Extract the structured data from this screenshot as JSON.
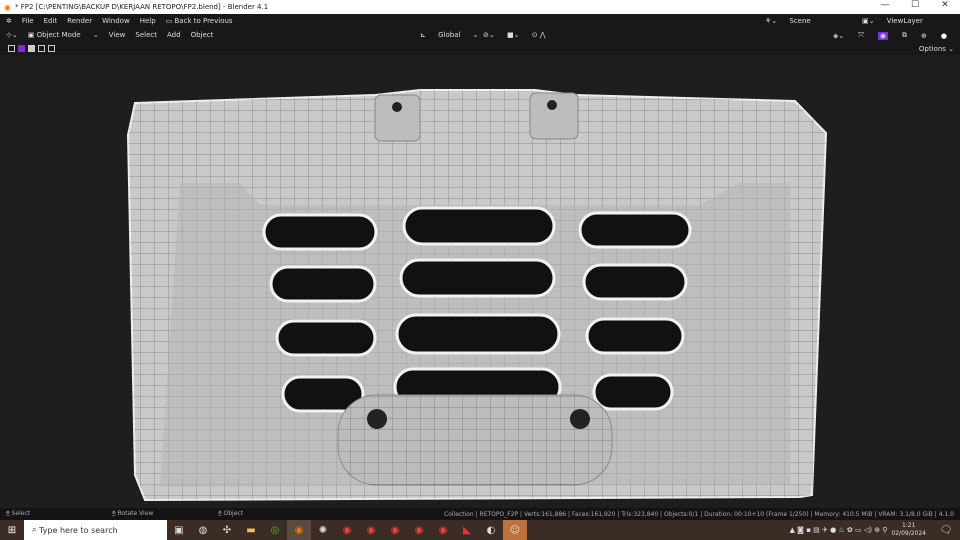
{
  "window": {
    "title": "* FP2 [C:\\PENTING\\BACKUP D\\KERJAAN RETOPO\\FP2.blend] - Blender 4.1",
    "minimize": "—",
    "maximize": "☐",
    "close": "✕"
  },
  "menu": {
    "items": [
      "File",
      "Edit",
      "Render",
      "Window",
      "Help"
    ],
    "back": "Back to Previous",
    "scene": "Scene",
    "view_layer": "ViewLayer"
  },
  "header": {
    "mode": "Object Mode",
    "items": [
      "View",
      "Select",
      "Add",
      "Object"
    ],
    "orientation": "Global",
    "options": "Options"
  },
  "status": {
    "left": [
      {
        "label": "Select"
      },
      {
        "label": "Rotate View"
      },
      {
        "label": "Object"
      }
    ],
    "stats": "Collection | RETOPO_F2P | Verts:161,886 | Faces:161,920 | Tris:323,840 | Objects:0/1 | Duration: 00:10+10 (Frame 1/250) | Memory: 410.5 MiB | VRAM: 3.1/8.0 GiB | 4.1.0"
  },
  "taskbar": {
    "search_placeholder": "Type here to search",
    "time": "1:21",
    "date": "02/09/2024"
  },
  "colors": {
    "accent": "#7a2de0",
    "mesh": "#c8c8c8"
  }
}
